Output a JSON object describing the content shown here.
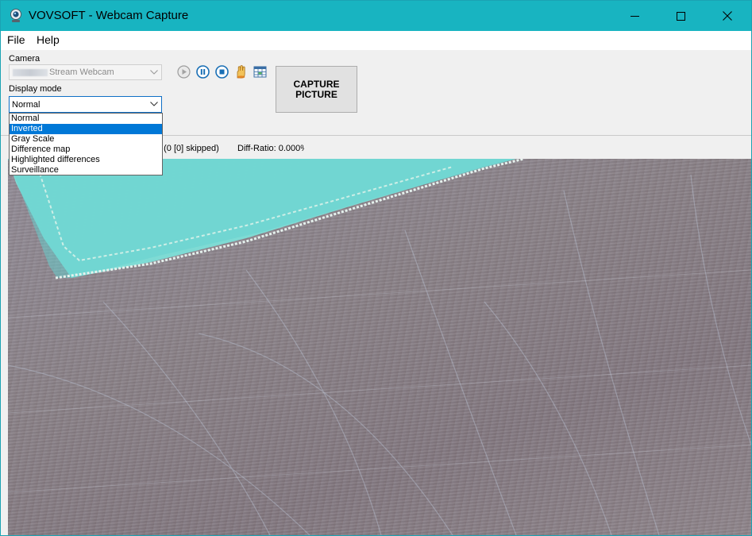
{
  "window": {
    "title": "VOVSOFT - Webcam Capture",
    "accent_color": "#18b4c1"
  },
  "menu": {
    "file": "File",
    "help": "Help"
  },
  "camera": {
    "label": "Camera",
    "value": "Stream Webcam"
  },
  "display_mode": {
    "label": "Display mode",
    "value": "Normal",
    "options": [
      {
        "label": "Normal",
        "selected": false
      },
      {
        "label": "Inverted",
        "selected": true
      },
      {
        "label": "Gray Scale",
        "selected": false
      },
      {
        "label": "Difference map",
        "selected": false
      },
      {
        "label": "Highlighted differences",
        "selected": false
      },
      {
        "label": "Surveillance",
        "selected": false
      }
    ]
  },
  "toolbar": {
    "icons": [
      "play-icon",
      "pause-icon",
      "stop-icon",
      "hand-icon",
      "grid-icon"
    ],
    "capture_label_line1": "CAPTURE",
    "capture_label_line2": "PICTURE"
  },
  "status": {
    "frames_text": "] (0 [0] skipped)",
    "diff_text": "Diff-Ratio: 0.000%"
  }
}
